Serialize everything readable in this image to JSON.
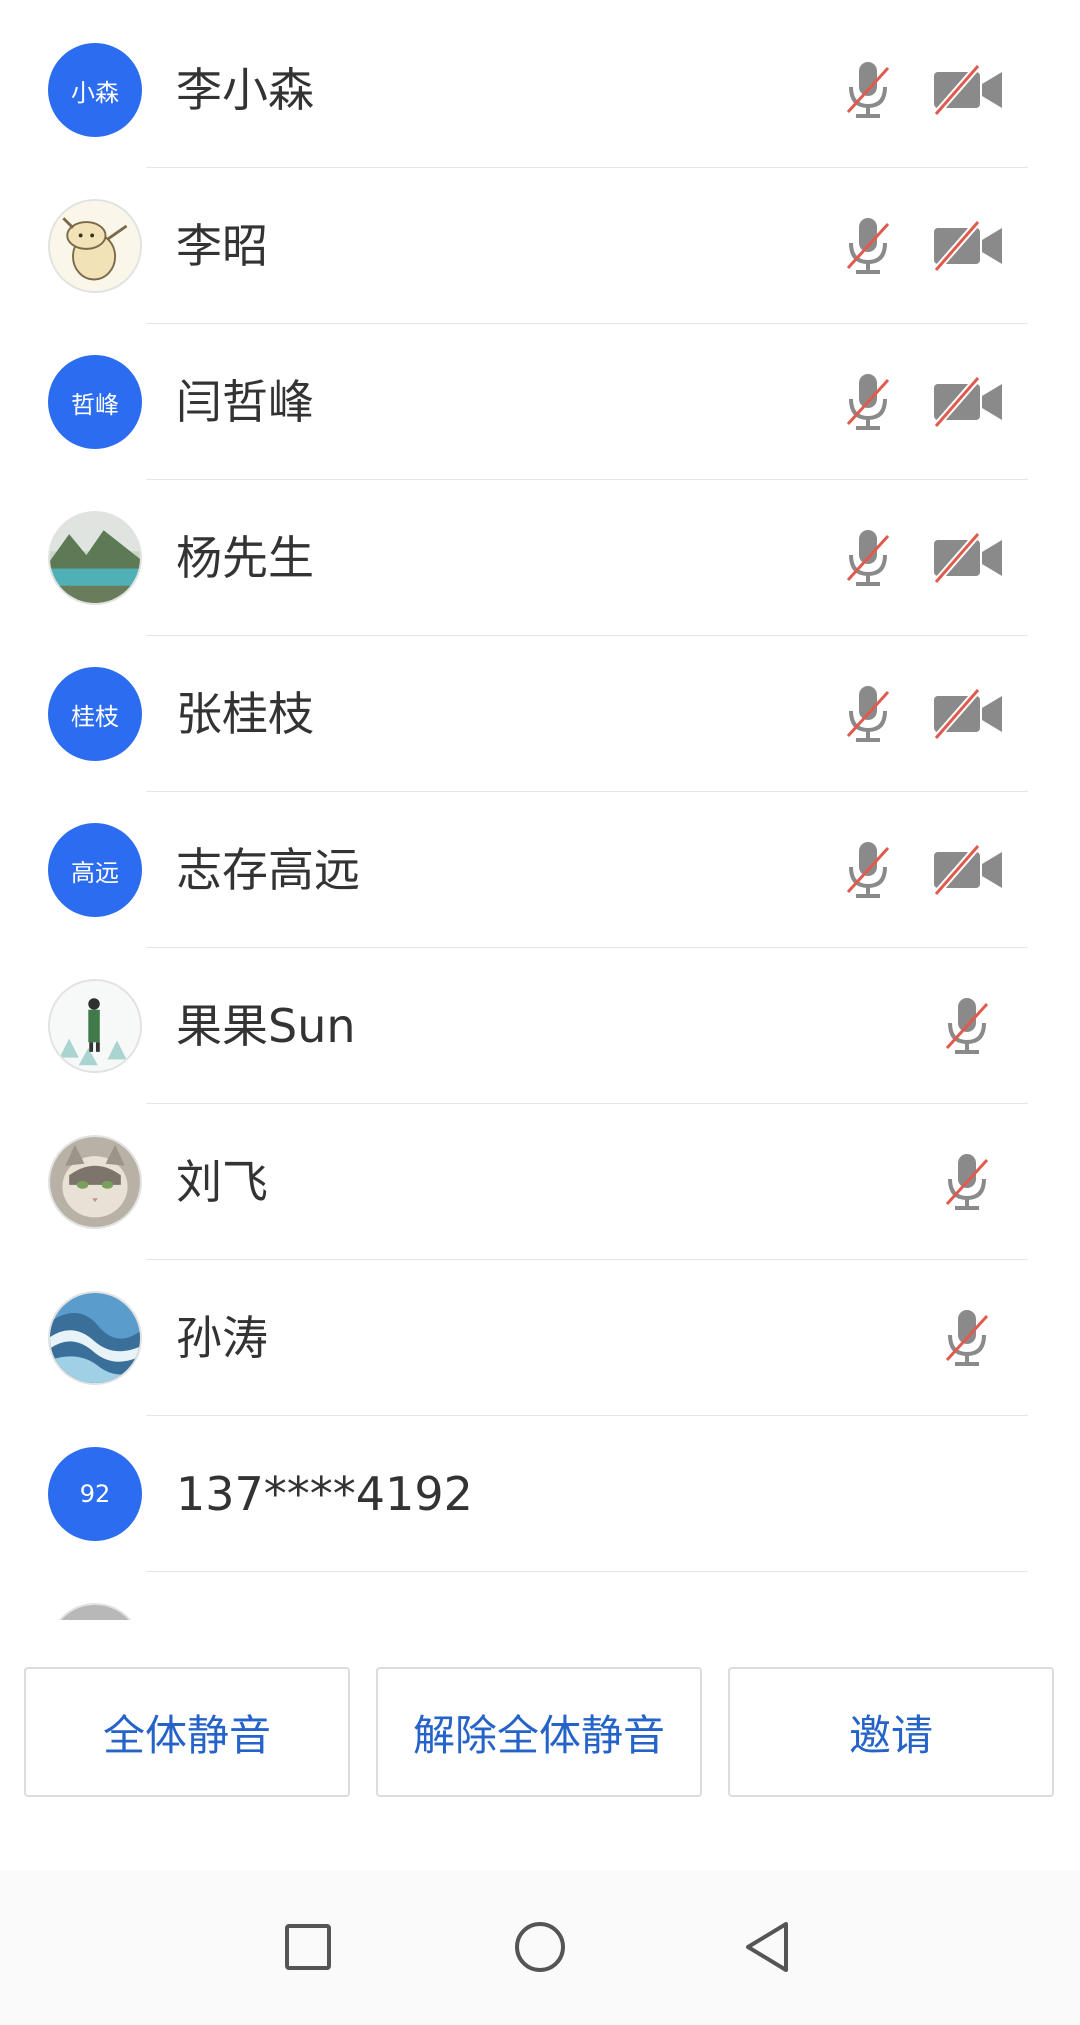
{
  "participants": [
    {
      "name": "李小森",
      "avatar_text": "小森",
      "avatar_icon": "",
      "mic_muted": true,
      "video_off": true
    },
    {
      "name": "李昭",
      "avatar_text": "",
      "avatar_icon": "cartoon-dog-avatar",
      "mic_muted": true,
      "video_off": true
    },
    {
      "name": "闫哲峰",
      "avatar_text": "哲峰",
      "avatar_icon": "",
      "mic_muted": true,
      "video_off": true
    },
    {
      "name": "杨先生",
      "avatar_text": "",
      "avatar_icon": "landscape-photo-avatar",
      "mic_muted": true,
      "video_off": true
    },
    {
      "name": "张桂枝",
      "avatar_text": "桂枝",
      "avatar_icon": "",
      "mic_muted": true,
      "video_off": true
    },
    {
      "name": "志存高远",
      "avatar_text": "高远",
      "avatar_icon": "",
      "mic_muted": true,
      "video_off": true
    },
    {
      "name": "果果Sun",
      "avatar_text": "",
      "avatar_icon": "person-in-snow-avatar",
      "mic_muted": true,
      "video_off": null
    },
    {
      "name": "刘飞",
      "avatar_text": "",
      "avatar_icon": "cat-photo-avatar",
      "mic_muted": true,
      "video_off": null
    },
    {
      "name": "孙涛",
      "avatar_text": "",
      "avatar_icon": "river-photo-avatar",
      "mic_muted": true,
      "video_off": null
    },
    {
      "name": "137****4192",
      "avatar_text": "92",
      "avatar_icon": "",
      "mic_muted": null,
      "video_off": null
    }
  ],
  "actions": {
    "mute_all": "全体静音",
    "unmute_all": "解除全体静音",
    "invite": "邀请"
  },
  "nav": {
    "recents_icon": "square-icon",
    "home_icon": "circle-icon",
    "back_icon": "triangle-back-icon"
  },
  "colors": {
    "avatar_blue": "#2b6cf0",
    "button_text_blue": "#2563c9",
    "muted_slash_red": "#e05a4e",
    "icon_gray": "#8a8a8a"
  }
}
